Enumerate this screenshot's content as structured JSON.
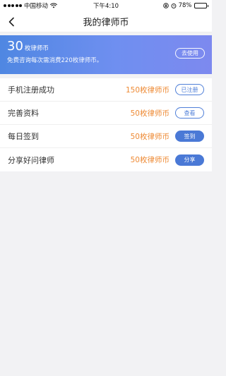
{
  "status_bar": {
    "carrier": "中国移动",
    "time": "下午4:10",
    "battery": "78%",
    "battery_level": 0.78,
    "icons": [
      "signal-dots-icon",
      "wifi-icon",
      "lock-rotation-icon",
      "alarm-icon",
      "battery-icon"
    ]
  },
  "nav": {
    "title": "我的律师币",
    "back_icon": "chevron-left-icon"
  },
  "banner": {
    "count": "30",
    "unit": "枚律师币",
    "description": "免费咨询每次需消费220枚律师币。",
    "use_button": "去使用",
    "gradient_start": "#4f87e2",
    "gradient_end": "#7d89ef"
  },
  "tasks": [
    {
      "label": "手机注册成功",
      "reward": "150枚律师币",
      "button": "已注册",
      "style": "outline"
    },
    {
      "label": "完善资料",
      "reward": "50枚律师币",
      "button": "查看",
      "style": "outline"
    },
    {
      "label": "每日签到",
      "reward": "50枚律师币",
      "button": "签到",
      "style": "filled"
    },
    {
      "label": "分享好问律师",
      "reward": "50枚律师币",
      "button": "分享",
      "style": "filled"
    }
  ],
  "colors": {
    "accent": "#4a79d6",
    "reward": "#ee8a34",
    "background": "#f2f2f4"
  }
}
